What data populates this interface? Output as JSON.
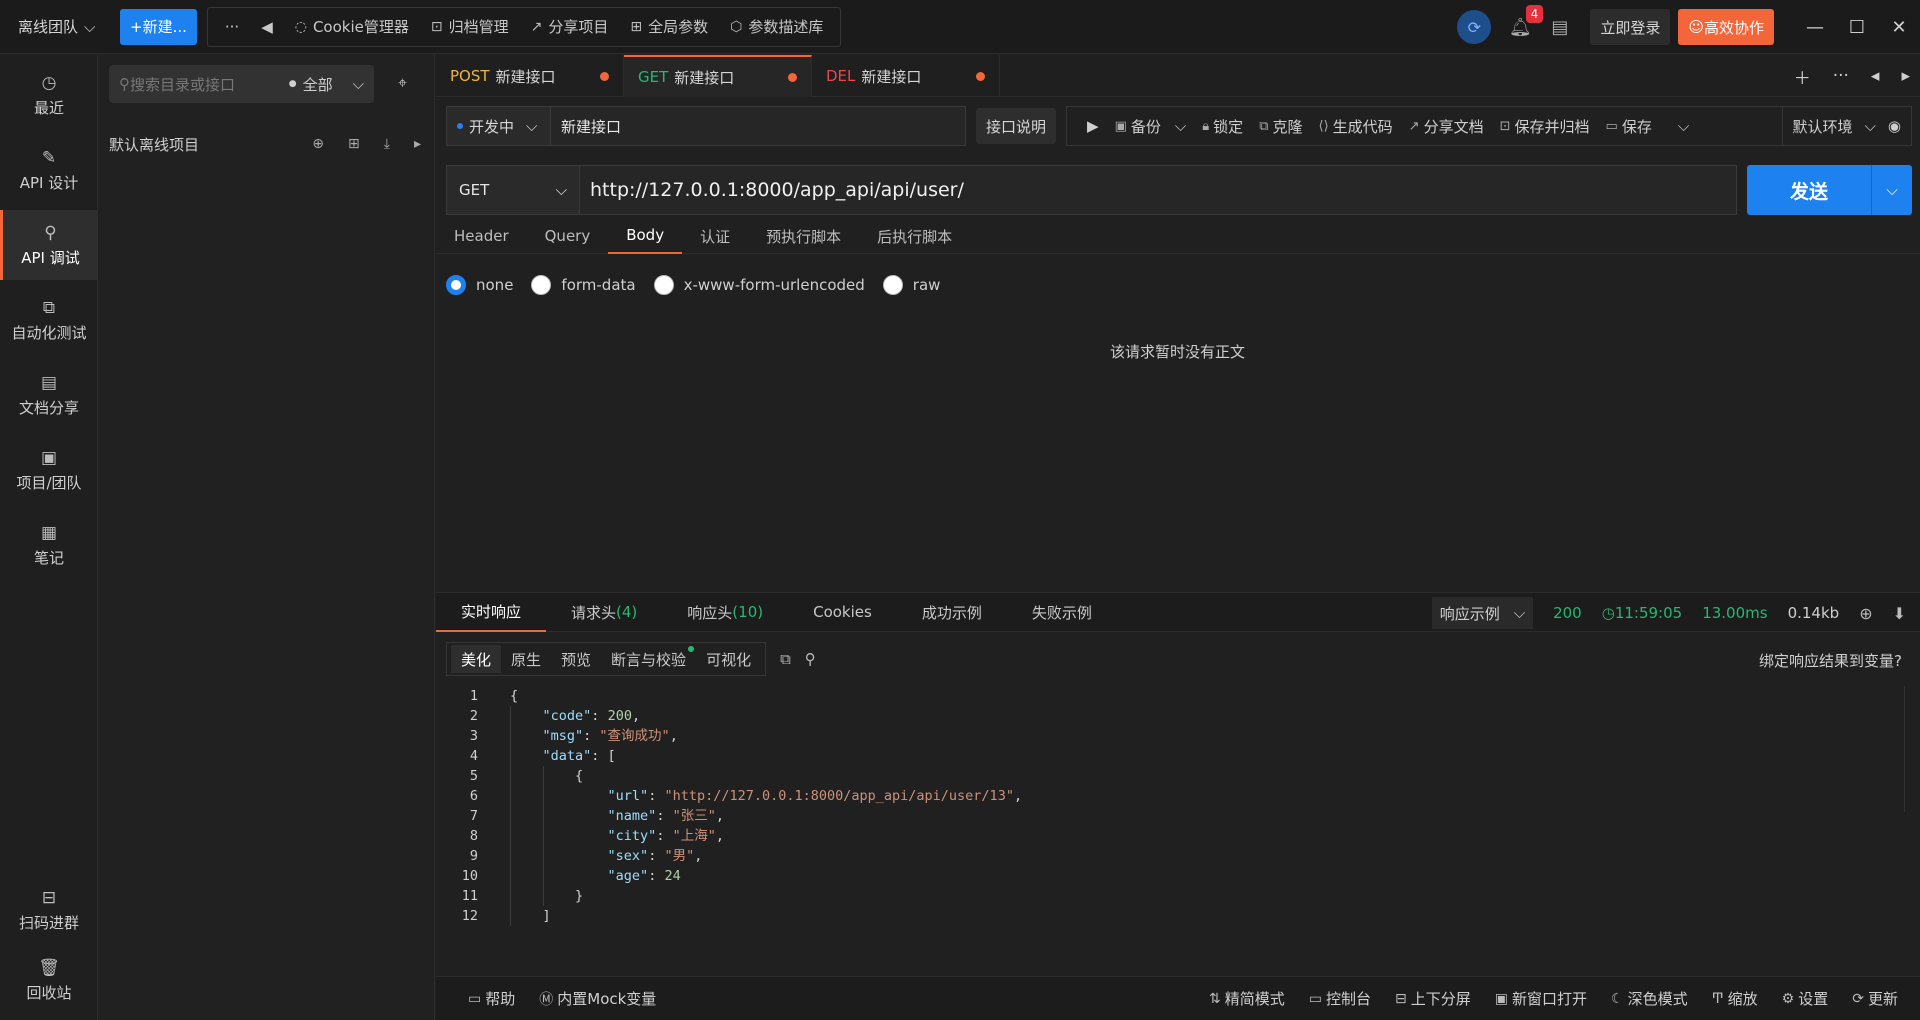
{
  "titlebar": {
    "team": "离线团队",
    "new_button": "+新建...",
    "more": "···",
    "tools": [
      {
        "icon": "cookie-icon",
        "label": "Cookie管理器"
      },
      {
        "icon": "archive-icon",
        "label": "归档管理"
      },
      {
        "icon": "share-icon",
        "label": "分享项目"
      },
      {
        "icon": "global-params-icon",
        "label": "全局参数"
      },
      {
        "icon": "param-library-icon",
        "label": "参数描述库"
      }
    ],
    "notification_count": "4",
    "login": "立即登录",
    "collab": "高效协作"
  },
  "rail": {
    "items": [
      {
        "label": "最近",
        "icon": "clock-icon"
      },
      {
        "label": "API 设计",
        "icon": "edit-icon"
      },
      {
        "label": "API 调试",
        "icon": "debug-icon",
        "active": true
      },
      {
        "label": "自动化测试",
        "icon": "flow-icon"
      },
      {
        "label": "文档分享",
        "icon": "doc-icon"
      },
      {
        "label": "项目/团队",
        "icon": "project-icon"
      },
      {
        "label": "笔记",
        "icon": "note-icon"
      }
    ],
    "bottom": [
      {
        "label": "扫码进群",
        "icon": "scan-icon"
      },
      {
        "label": "回收站",
        "icon": "trash-icon"
      }
    ]
  },
  "tree": {
    "search_placeholder": "搜索目录或接口",
    "scope": "全部",
    "project": "默认离线项目"
  },
  "tabs": [
    {
      "method": "POST",
      "name": "新建接口"
    },
    {
      "method": "GET",
      "name": "新建接口",
      "active": true
    },
    {
      "method": "DEL",
      "name": "新建接口"
    }
  ],
  "meta": {
    "status": "开发中",
    "name": "新建接口",
    "desc_button": "接口说明",
    "actions": [
      "备份",
      "锁定",
      "克隆",
      "生成代码",
      "分享文档",
      "保存并归档",
      "保存"
    ],
    "env": "默认环境"
  },
  "request": {
    "method": "GET",
    "url": "http://127.0.0.1:8000/app_api/api/user/",
    "send": "发送",
    "subtabs": [
      "Header",
      "Query",
      "Body",
      "认证",
      "预执行脚本",
      "后执行脚本"
    ],
    "active_subtab": "Body",
    "body_modes": [
      "none",
      "form-data",
      "x-www-form-urlencoded",
      "raw"
    ],
    "selected_body_mode": "none",
    "empty_text": "该请求暂时没有正文"
  },
  "response": {
    "tabs": [
      {
        "label": "实时响应",
        "count": ""
      },
      {
        "label": "请求头",
        "count": "(4)"
      },
      {
        "label": "响应头",
        "count": "(10)"
      },
      {
        "label": "Cookies",
        "count": ""
      },
      {
        "label": "成功示例",
        "count": ""
      },
      {
        "label": "失败示例",
        "count": ""
      }
    ],
    "example_select": "响应示例",
    "status": "200",
    "time": "11:59:05",
    "duration": "13.00ms",
    "size": "0.14kb",
    "views": [
      "美化",
      "原生",
      "预览",
      "断言与校验",
      "可视化"
    ],
    "bind_link": "绑定响应结果到变量?",
    "code_lines": [
      "1",
      "2",
      "3",
      "4",
      "5",
      "6",
      "7",
      "8",
      "9",
      "10",
      "11",
      "12"
    ],
    "json": {
      "code": "200",
      "msg": "\"查询成功\"",
      "url": "\"http://127.0.0.1:8000/app_api/api/user/13\"",
      "name": "\"张三\"",
      "city": "\"上海\"",
      "sex": "\"男\"",
      "age": "24"
    }
  },
  "statusbar": {
    "left": [
      {
        "icon": "help-icon",
        "label": "帮助"
      },
      {
        "icon": "mock-icon",
        "label": "内置Mock变量"
      }
    ],
    "right": [
      {
        "icon": "compact-icon",
        "label": "精简模式"
      },
      {
        "icon": "console-icon",
        "label": "控制台"
      },
      {
        "icon": "split-icon",
        "label": "上下分屏"
      },
      {
        "icon": "window-icon",
        "label": "新窗口打开"
      },
      {
        "icon": "moon-icon",
        "label": "深色模式"
      },
      {
        "icon": "font-scale-icon",
        "label": "缩放"
      },
      {
        "icon": "settings-icon",
        "label": "设置"
      },
      {
        "icon": "update-icon",
        "label": "更新"
      }
    ]
  }
}
